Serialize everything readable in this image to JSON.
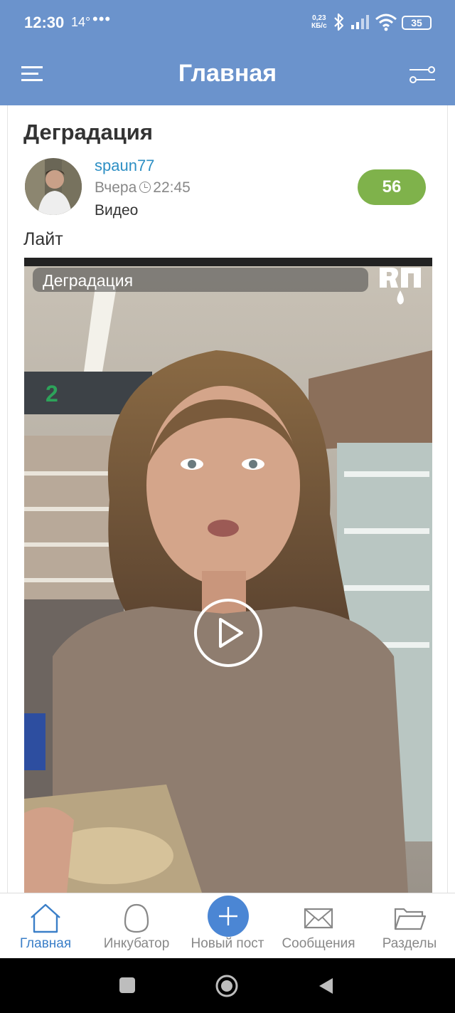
{
  "status_bar": {
    "time": "12:30",
    "temperature": "14°",
    "dots": "•••",
    "net_speed_value": "0,23",
    "net_speed_unit": "КБ/с",
    "battery": "35"
  },
  "app_bar": {
    "title": "Главная",
    "menu_icon": "hamburger-icon",
    "filter_icon": "filter-sliders-icon"
  },
  "post": {
    "title": "Деградация",
    "author": "spaun77",
    "date_label": "Вчера",
    "time": "22:45",
    "category": "Видео",
    "rating": "56",
    "text": "Лайт",
    "video": {
      "caption": "Деградация",
      "logo_icon": "yap-logo-icon",
      "play_icon": "play-icon"
    }
  },
  "bottom_nav": {
    "items": [
      {
        "label": "Главная",
        "icon": "home-icon",
        "active": true
      },
      {
        "label": "Инкубатор",
        "icon": "egg-icon",
        "active": false
      },
      {
        "label": "Новый пост",
        "icon": "plus-icon",
        "active": false
      },
      {
        "label": "Сообщения",
        "icon": "envelope-icon",
        "active": false
      },
      {
        "label": "Разделы",
        "icon": "folder-icon",
        "active": false
      }
    ]
  },
  "colors": {
    "header_blue": "#6b93cc",
    "accent_blue": "#3b7fc8",
    "author_link": "#2d8fc4",
    "rating_green": "#7fb24b"
  }
}
